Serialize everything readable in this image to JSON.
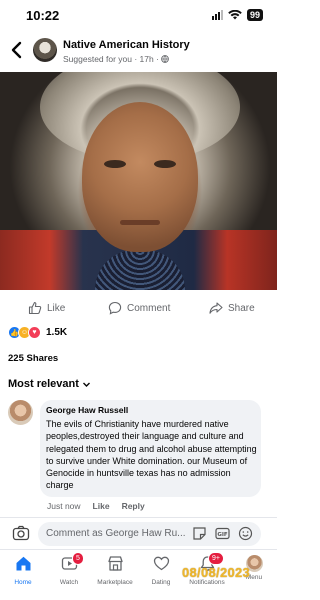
{
  "status": {
    "time": "10:22",
    "battery": "99"
  },
  "header": {
    "title": "Native American History",
    "subtitle": "Suggested for you · 17h · "
  },
  "actions": {
    "like": "Like",
    "comment": "Comment",
    "share": "Share"
  },
  "reactions": {
    "count": "1.5K",
    "types": [
      "like-icon",
      "care-icon",
      "love-icon"
    ]
  },
  "shares": "225 Shares",
  "sort": {
    "label": "Most relevant"
  },
  "comment": {
    "author": "George Haw Russell",
    "text": "The evils of Christianity have murdered native peoples,destroyed their language and culture and relegated them to drug and alcohol abuse attempting to survive under White domination. our Museum of Genocide in huntsville texas has no admission charge",
    "time": "Just now",
    "like": "Like",
    "reply": "Reply"
  },
  "compose": {
    "placeholder": "Comment as George Haw Ru..."
  },
  "tabs": [
    {
      "label": "Home",
      "icon": "home-icon",
      "active": true
    },
    {
      "label": "Watch",
      "icon": "watch-icon",
      "badge": "5"
    },
    {
      "label": "Marketplace",
      "icon": "marketplace-icon"
    },
    {
      "label": "Dating",
      "icon": "dating-icon"
    },
    {
      "label": "Notifications",
      "icon": "bell-icon",
      "badge": "9+"
    },
    {
      "label": "Menu",
      "icon": "avatar"
    }
  ],
  "overlay_timestamp": "08/08/2023",
  "colors": {
    "accent": "#1877f2",
    "badge": "#e41e3f",
    "timestamp": "#f0b72a"
  }
}
